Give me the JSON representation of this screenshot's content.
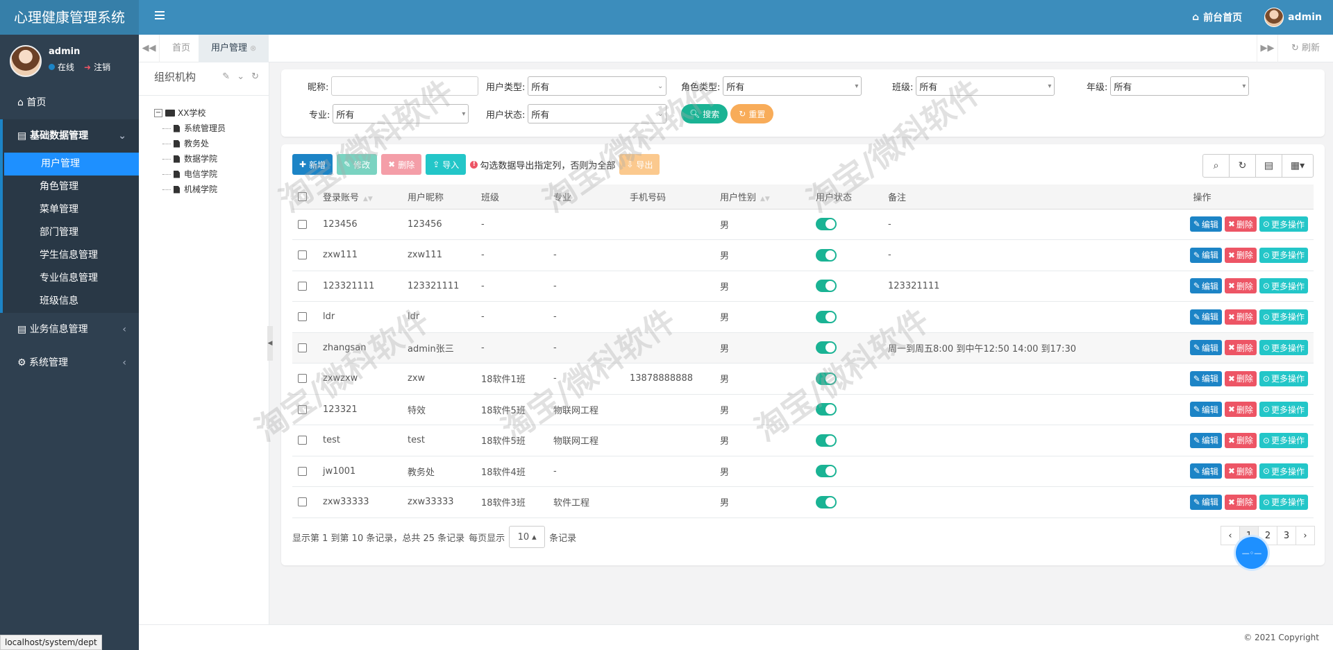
{
  "app": {
    "title": "心理健康管理系统"
  },
  "header": {
    "front_home": "前台首页",
    "user": "admin"
  },
  "sidebar": {
    "user_name": "admin",
    "online": "在线",
    "logout": "注销",
    "home": "首页",
    "group_basic": "基础数据管理",
    "basic_items": [
      "用户管理",
      "角色管理",
      "菜单管理",
      "部门管理",
      "学生信息管理",
      "专业信息管理",
      "班级信息"
    ],
    "group_business": "业务信息管理",
    "group_system": "系统管理"
  },
  "tabs": {
    "home": "首页",
    "user_mgmt": "用户管理",
    "refresh": "刷新"
  },
  "org": {
    "title": "组织机构",
    "root": "XX学校",
    "children": [
      "系统管理员",
      "教务处",
      "数据学院",
      "电信学院",
      "机械学院"
    ]
  },
  "search": {
    "nickname_label": "昵称:",
    "user_type_label": "用户类型:",
    "user_type_value": "所有",
    "role_type_label": "角色类型:",
    "role_type_value": "所有",
    "class_label": "班级:",
    "class_value": "所有",
    "grade_label": "年级:",
    "grade_value": "所有",
    "major_label": "专业:",
    "major_value": "所有",
    "status_label": "用户状态:",
    "status_value": "所有",
    "search_btn": "搜索",
    "reset_btn": "重置"
  },
  "toolbar": {
    "add": "新增",
    "edit": "修改",
    "delete": "删除",
    "import": "导入",
    "hint": "勾选数据导出指定列，否则为全部",
    "export": "导出"
  },
  "table": {
    "headers": [
      "登录账号",
      "用户昵称",
      "班级",
      "专业",
      "手机号码",
      "用户性别",
      "用户状态",
      "备注",
      "操作"
    ],
    "op_edit": "编辑",
    "op_delete": "删除",
    "op_more": "更多操作",
    "rows": [
      {
        "account": "123456",
        "nick": "123456",
        "cls": "-",
        "major": "",
        "phone": "",
        "sex": "男",
        "remark": "-"
      },
      {
        "account": "zxw111",
        "nick": "zxw111",
        "cls": "-",
        "major": "-",
        "phone": "",
        "sex": "男",
        "remark": "-"
      },
      {
        "account": "123321111",
        "nick": "123321111",
        "cls": "-",
        "major": "-",
        "phone": "",
        "sex": "男",
        "remark": "123321111"
      },
      {
        "account": "ldr",
        "nick": "ldr",
        "cls": "-",
        "major": "-",
        "phone": "",
        "sex": "男",
        "remark": ""
      },
      {
        "account": "zhangsan",
        "nick": "admin张三",
        "cls": "-",
        "major": "-",
        "phone": "",
        "sex": "男",
        "remark": "周一到周五8:00 到中午12:50 14:00 到17:30"
      },
      {
        "account": "zxwzxw",
        "nick": "zxw",
        "cls": "18软件1班",
        "major": "-",
        "phone": "13878888888",
        "sex": "男",
        "remark": ""
      },
      {
        "account": "123321",
        "nick": "特效",
        "cls": "18软件5班",
        "major": "物联网工程",
        "phone": "",
        "sex": "男",
        "remark": ""
      },
      {
        "account": "test",
        "nick": "test",
        "cls": "18软件5班",
        "major": "物联网工程",
        "phone": "",
        "sex": "男",
        "remark": ""
      },
      {
        "account": "jw1001",
        "nick": "教务处",
        "cls": "18软件4班",
        "major": "-",
        "phone": "",
        "sex": "男",
        "remark": ""
      },
      {
        "account": "zxw33333",
        "nick": "zxw33333",
        "cls": "18软件3班",
        "major": "软件工程",
        "phone": "",
        "sex": "男",
        "remark": ""
      }
    ]
  },
  "pager": {
    "info": "显示第 1 到第 10 条记录，总共 25 条记录",
    "per_page": "每页显示",
    "size": "10",
    "unit": "条记录",
    "pages": [
      "‹",
      "1",
      "2",
      "3",
      "›"
    ]
  },
  "footer": {
    "copyright": "© 2021 Copyright"
  },
  "status_url": "localhost/system/dept",
  "watermark": "淘宝/微科软件",
  "colors": {
    "header": "#3c8dbc",
    "sidebar": "#2f4050",
    "primary": "#1c84c6",
    "success": "#1ab394",
    "danger": "#ed5565",
    "info": "#23c6c8",
    "warning": "#f8ac59"
  }
}
